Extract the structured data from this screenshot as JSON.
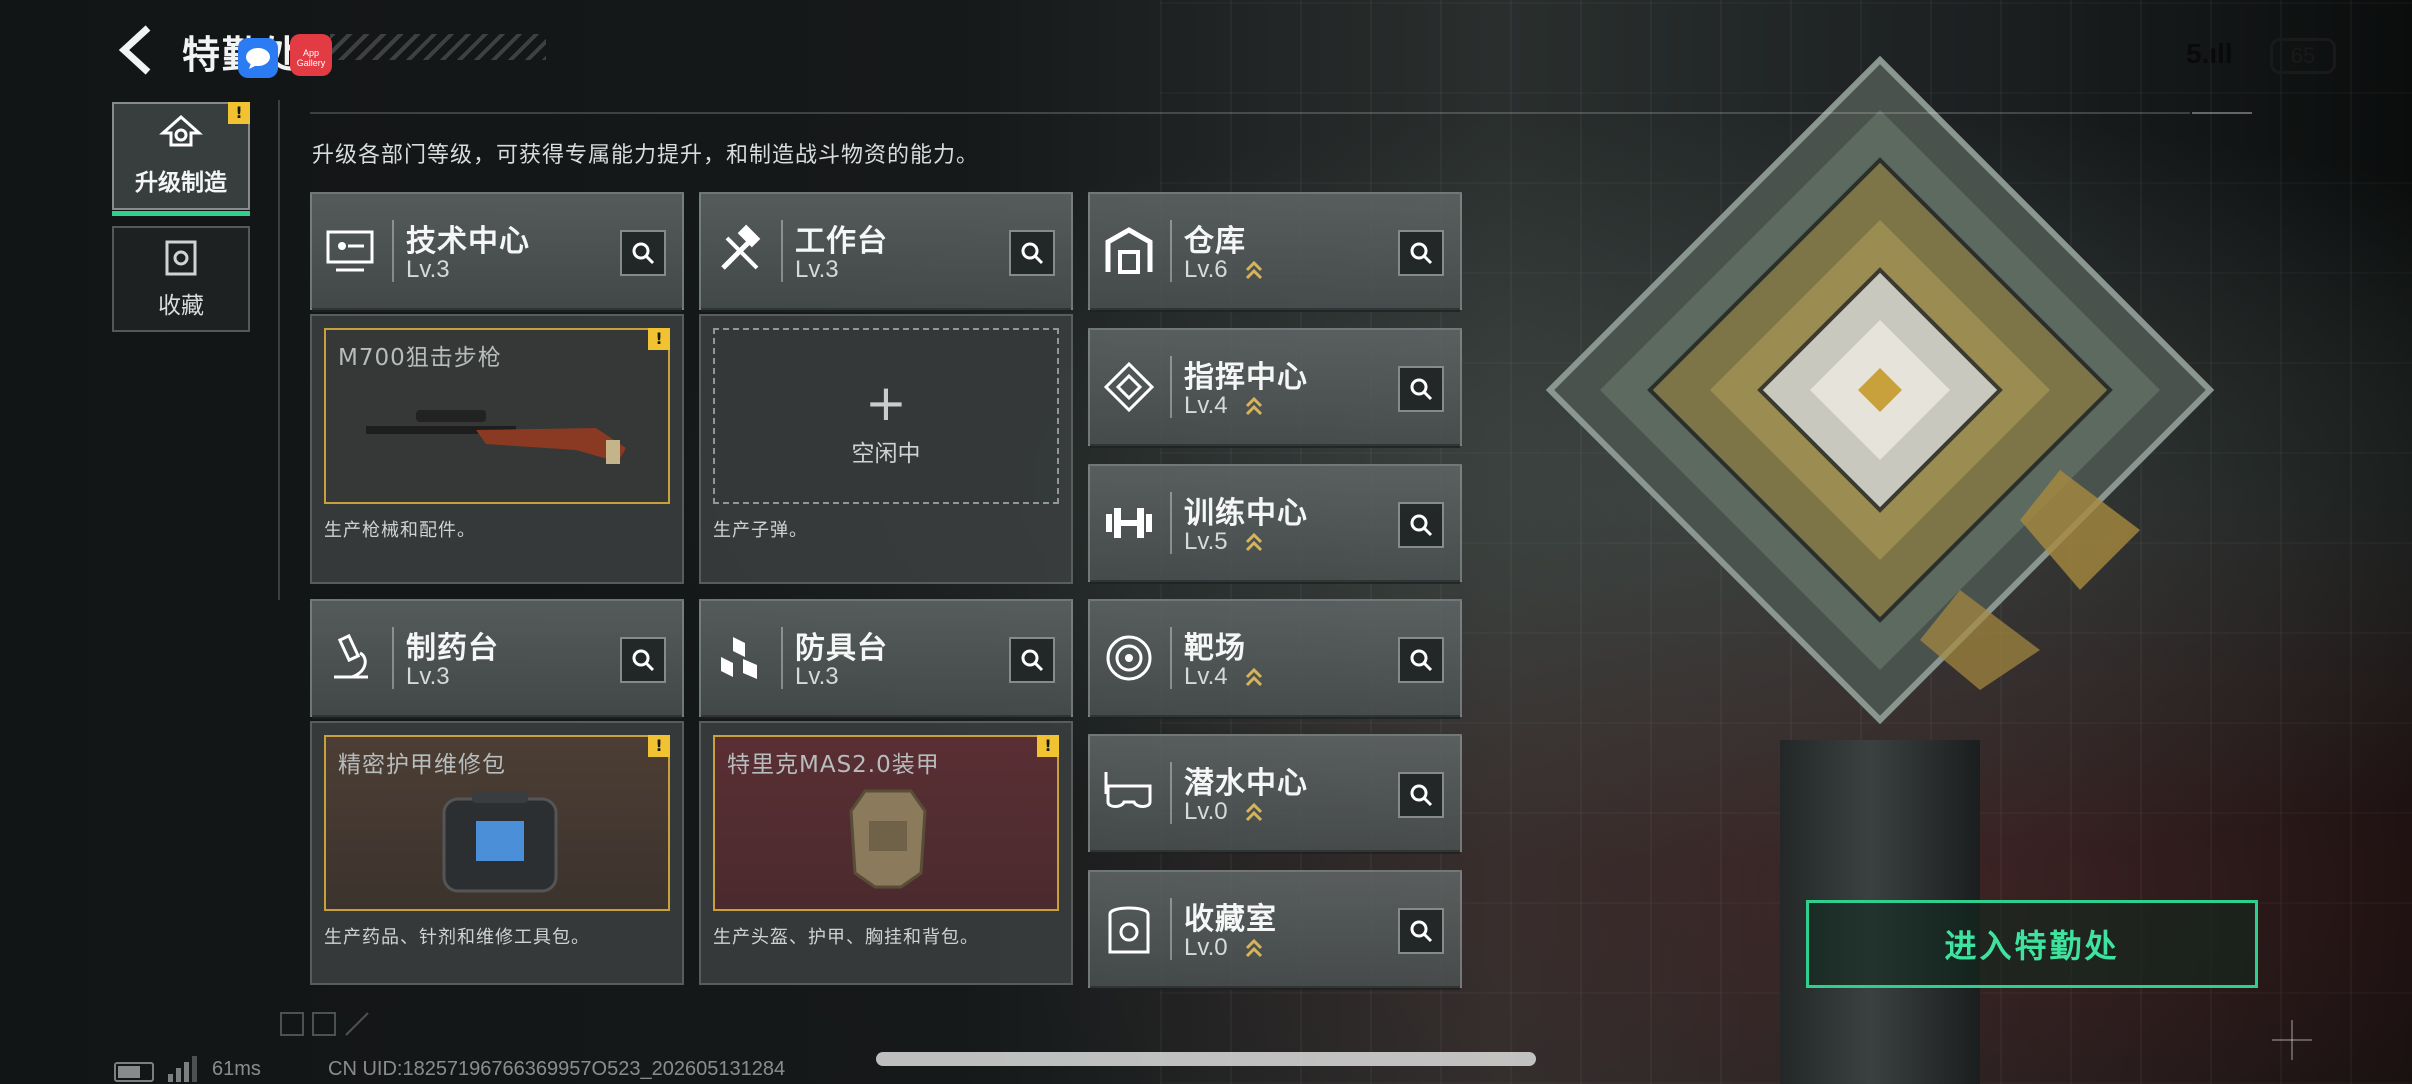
{
  "header": {
    "title": "特勤处",
    "app_badge_label": "App Gallery",
    "signal_text": "5.ıll",
    "battery_level": "65"
  },
  "sidebar": {
    "tabs": [
      {
        "label": "升级制造",
        "alert": "!"
      },
      {
        "label": "收藏"
      }
    ]
  },
  "description": "升级各部门等级，可获得专属能力提升，和制造战斗物资的能力。",
  "facilities": {
    "tech_center": {
      "name": "技术中心",
      "level": "Lv.3"
    },
    "workbench": {
      "name": "工作台",
      "level": "Lv.3"
    },
    "warehouse": {
      "name": "仓库",
      "level": "Lv.6"
    },
    "command_center": {
      "name": "指挥中心",
      "level": "Lv.4"
    },
    "training_center": {
      "name": "训练中心",
      "level": "Lv.5"
    },
    "pharmacy": {
      "name": "制药台",
      "level": "Lv.3"
    },
    "armor_bench": {
      "name": "防具台",
      "level": "Lv.3"
    },
    "shooting_range": {
      "name": "靶场",
      "level": "Lv.4"
    },
    "diving_center": {
      "name": "潜水中心",
      "level": "Lv.0"
    },
    "collection_room": {
      "name": "收藏室",
      "level": "Lv.0"
    }
  },
  "production": {
    "tech_center": {
      "item": "M700狙击步枪",
      "desc": "生产枪械和配件。",
      "alert": "!"
    },
    "workbench": {
      "plus": "+",
      "status": "空闲中",
      "desc": "生产子弹。"
    },
    "pharmacy": {
      "item": "精密护甲维修包",
      "desc": "生产药品、针剂和维修工具包。",
      "alert": "!"
    },
    "armor_bench": {
      "item": "特里克MAS2.0装甲",
      "desc": "生产头盔、护甲、胸挂和背包。",
      "alert": "!"
    }
  },
  "enter_button": {
    "label": "进入特勤处"
  },
  "footer": {
    "ping": "61ms",
    "uid": "CN UID:18257196766369957O523_202605131284"
  },
  "colors": {
    "accent_green": "#2fd08e",
    "alert_yellow": "#f1c232",
    "slot_gold": "#c9a13c",
    "level_chevron": "#d7b35a"
  },
  "icons": {
    "back": "back-arrow-icon",
    "search": "magnifier-icon",
    "upgrade": "upgrade-arrow-icon",
    "collection": "trophy-box-icon"
  }
}
